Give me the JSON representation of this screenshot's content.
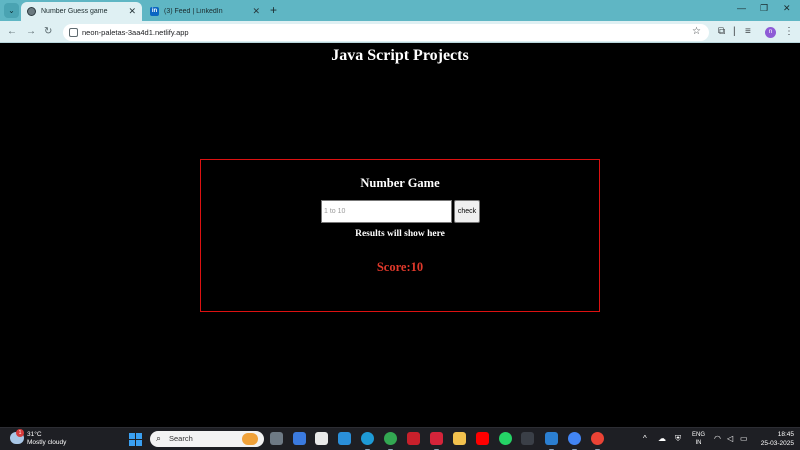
{
  "browser": {
    "tabs": [
      {
        "title": "Number Guess game",
        "active": true
      },
      {
        "title": "(3) Feed | LinkedIn",
        "active": false
      }
    ],
    "new_tab_glyph": "+",
    "url": "neon-paletas-3aa4d1.netlify.app",
    "window_controls": {
      "minimize": "—",
      "restore": "❐",
      "close": "✕"
    }
  },
  "page": {
    "heading": "Java Script Projects",
    "game": {
      "title": "Number Game",
      "input_placeholder": "1 to 10",
      "check_label": "check",
      "result_text": "Results will show here",
      "score_text": "Score:10"
    }
  },
  "taskbar": {
    "weather": {
      "temp": "31°C",
      "condition": "Mostly cloudy",
      "badge": "1"
    },
    "search_label": "Search",
    "language": {
      "line1": "ENG",
      "line2": "IN"
    },
    "clock": {
      "time": "18:45",
      "date": "25-03-2025"
    }
  },
  "colors": {
    "tabstrip": "#5fb6c4",
    "toolbar": "#dff0f3",
    "page_background": "#000000",
    "game_border": "#dd1111",
    "score": "#e0392b",
    "taskbar": "#1e1f24"
  }
}
